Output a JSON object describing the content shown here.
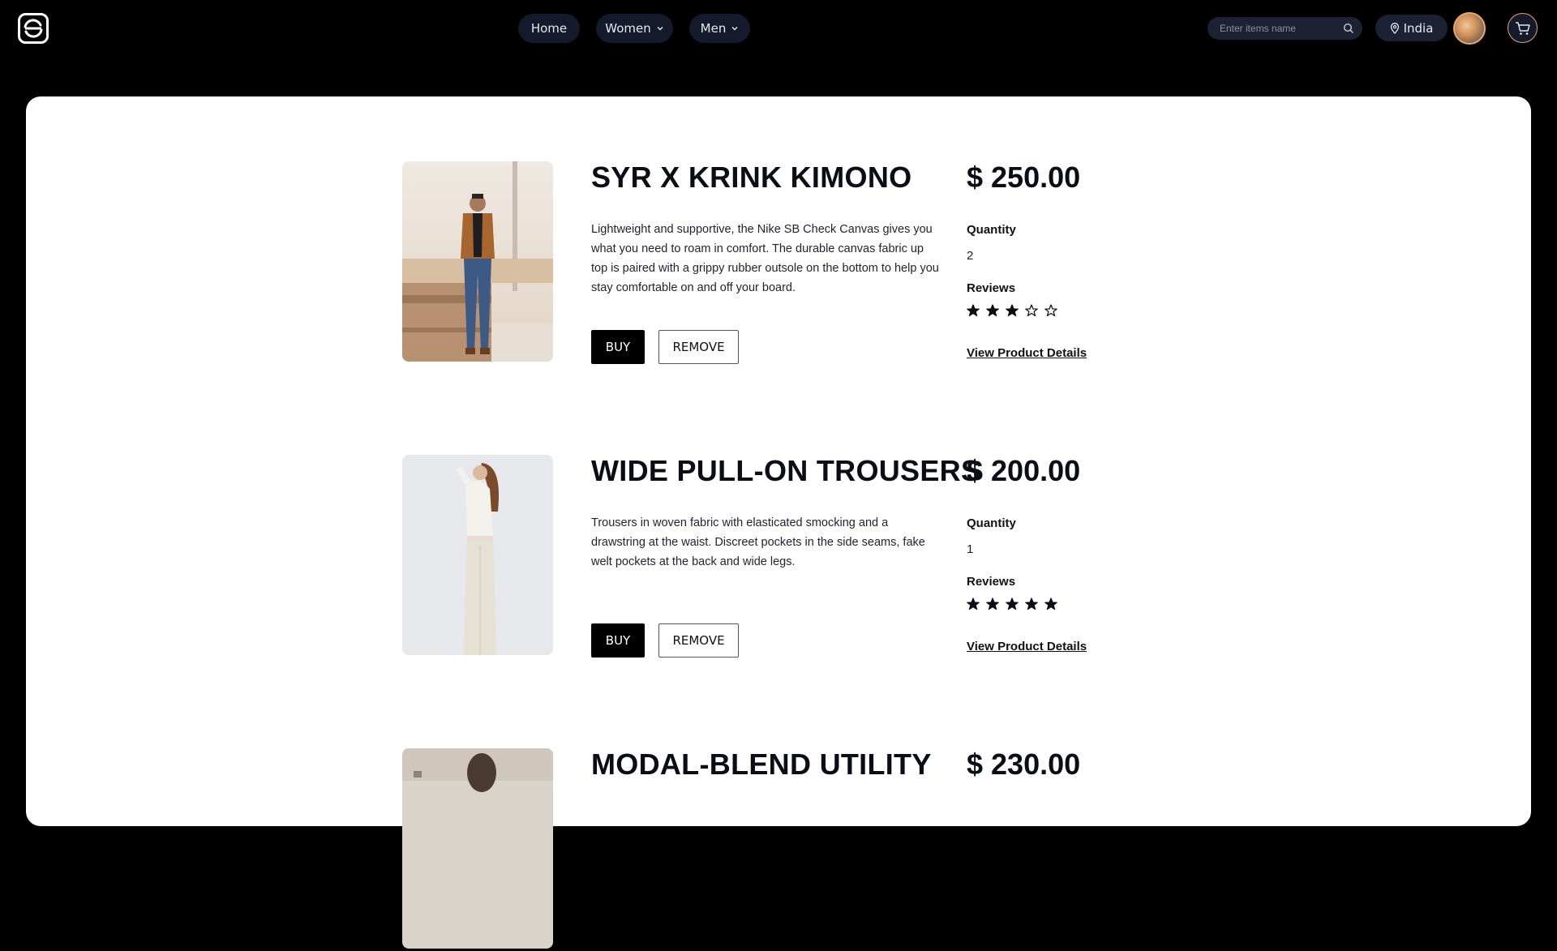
{
  "header": {
    "logo_icon": "logo-icon",
    "nav": [
      {
        "label": "Home",
        "dropdown": false
      },
      {
        "label": "Women",
        "dropdown": true
      },
      {
        "label": "Men",
        "dropdown": true
      }
    ],
    "search": {
      "placeholder": "Enter items name",
      "value": "",
      "icon": "search-icon"
    },
    "location": {
      "label": "India",
      "icon": "location-pin-icon"
    },
    "avatar_icon": "avatar",
    "cart_icon": "cart-icon"
  },
  "products": [
    {
      "title": "SYR X KRINK KIMONO",
      "description": "Lightweight and supportive, the Nike SB Check Canvas gives you what you need to roam in comfort. The durable canvas fabric up top is paired with a grippy rubber outsole on the bottom to help you stay comfortable on and off your board.",
      "buy_label": "BUY",
      "remove_label": "REMOVE",
      "price": "$ 250.00",
      "quantity_label": "Quantity",
      "quantity": "2",
      "reviews_label": "Reviews",
      "rating": 3,
      "rating_max": 5,
      "view_label": "View Product Details"
    },
    {
      "title": "WIDE PULL-ON TROUSERS",
      "description": "Trousers in woven fabric with elasticated smocking and a drawstring at the waist. Discreet pockets in the side seams, fake welt pockets at the back and wide legs.",
      "buy_label": "BUY",
      "remove_label": "REMOVE",
      "price": "$ 200.00",
      "quantity_label": "Quantity",
      "quantity": "1",
      "reviews_label": "Reviews",
      "rating": 5,
      "rating_max": 5,
      "view_label": "View Product Details"
    },
    {
      "title": "MODAL-BLEND UTILITY",
      "price": "$ 230.00"
    }
  ],
  "colors": {
    "background": "#000000",
    "nav_pill": "#141a2b",
    "card": "#ffffff",
    "accent_orange": "#e8a36a",
    "text_dark": "#0a0d16"
  }
}
